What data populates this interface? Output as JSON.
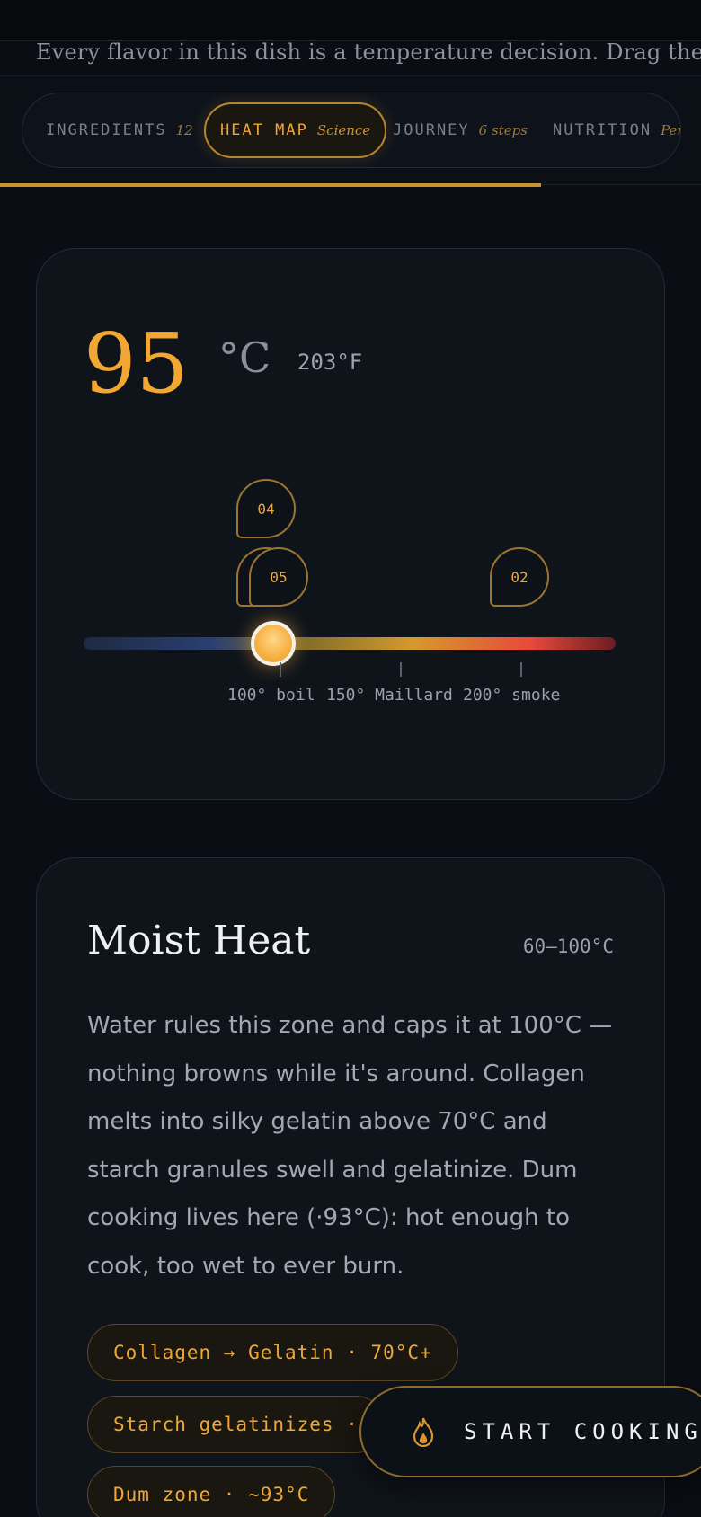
{
  "intro_text": "Every flavor in this dish is a temperature decision. Drag the",
  "tabs": [
    {
      "label": "INGREDIENTS",
      "sub": "12"
    },
    {
      "label": "HEAT MAP",
      "sub": "Science"
    },
    {
      "label": "JOURNEY",
      "sub": "6 steps"
    },
    {
      "label": "NUTRITION",
      "sub": "Per serving"
    }
  ],
  "heatmap": {
    "temp_c": "95",
    "unit_c": "°C",
    "temp_f": "203°F",
    "slider_value_c": 95,
    "markers": [
      "04",
      "05",
      "02"
    ],
    "hidden_marker": "0",
    "ticks": [
      "100° boil",
      "150° Maillard",
      "200° smoke"
    ]
  },
  "zone": {
    "title": "Moist Heat",
    "range": "60–100°C",
    "description": "Water rules this zone and caps it at 100°C — nothing browns while it's around. Collagen melts into silky gelatin above 70°C and starch granules swell and gelatinize. Dum cooking lives here (·93°C): hot enough to cook, too wet to ever burn.",
    "chips": [
      "Collagen → Gelatin · 70°C+",
      "Starch gelatinizes ·",
      "Dum zone · ~93°C"
    ]
  },
  "cta": {
    "label": "START COOKING",
    "icon": "flame-icon"
  },
  "colors": {
    "accent": "#f0a733",
    "background": "#0a0d13",
    "card": "#0f141b"
  }
}
